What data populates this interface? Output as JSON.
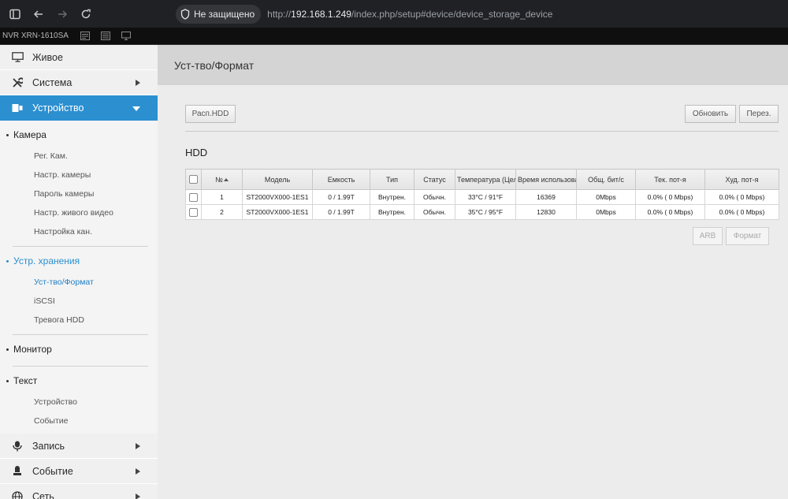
{
  "browser": {
    "security_label": "Не защищено",
    "url_prefix": "http://",
    "url_host": "192.168.1.249",
    "url_path": "/index.php/setup#device/device_storage_device"
  },
  "device": {
    "name": "NVR XRN-1610SA"
  },
  "sidebar": {
    "main_items": [
      {
        "label": "Живое",
        "icon": "monitor-icon"
      },
      {
        "label": "Система",
        "icon": "tools-icon"
      },
      {
        "label": "Устройство",
        "icon": "device-icon"
      },
      {
        "label": "Запись",
        "icon": "record-icon"
      },
      {
        "label": "Событие",
        "icon": "event-icon"
      },
      {
        "label": "Сеть",
        "icon": "network-icon"
      }
    ],
    "sections": {
      "camera": {
        "title": "Камера",
        "items": [
          "Рег. Кам.",
          "Настр. камеры",
          "Пароль камеры",
          "Настр. живого видео",
          "Настройка кан."
        ]
      },
      "storage": {
        "title": "Устр. хранения",
        "items": [
          "Уст-тво/Формат",
          "iSCSI",
          "Тревога HDD"
        ]
      },
      "monitor": {
        "title": "Монитор"
      },
      "text": {
        "title": "Текст",
        "items": [
          "Устройство",
          "Событие"
        ]
      }
    }
  },
  "page": {
    "title": "Уст-тво/Формат",
    "hdd_info_button": "Расп.HDD",
    "refresh_button": "Обновить",
    "reset_button": "Перез.",
    "section_title": "HDD",
    "arb_button": "ARB",
    "format_button": "Формат"
  },
  "table": {
    "headers": [
      "№",
      "Модель",
      "Емкость",
      "Тип",
      "Статус",
      "Температура (Цел",
      "Время использова",
      "Общ. бит/с",
      "Тек. пот-я",
      "Худ. пот-я"
    ],
    "rows": [
      [
        "1",
        "ST2000VX000-1ES1",
        "0 / 1.99T",
        "Внутрен.",
        "Обычн.",
        "33°C / 91°F",
        "16369",
        "0Mbps",
        "0.0% ( 0 Mbps)",
        "0.0% ( 0 Mbps)"
      ],
      [
        "2",
        "ST2000VX000-1ES1",
        "0 / 1.99T",
        "Внутрен.",
        "Обычн.",
        "35°C / 95°F",
        "12830",
        "0Mbps",
        "0.0% ( 0 Mbps)",
        "0.0% ( 0 Mbps)"
      ]
    ]
  },
  "colors": {
    "accent": "#2b8fd0",
    "sidebar_bg": "#f4f4f4",
    "header_bg": "#d4d4d4"
  }
}
